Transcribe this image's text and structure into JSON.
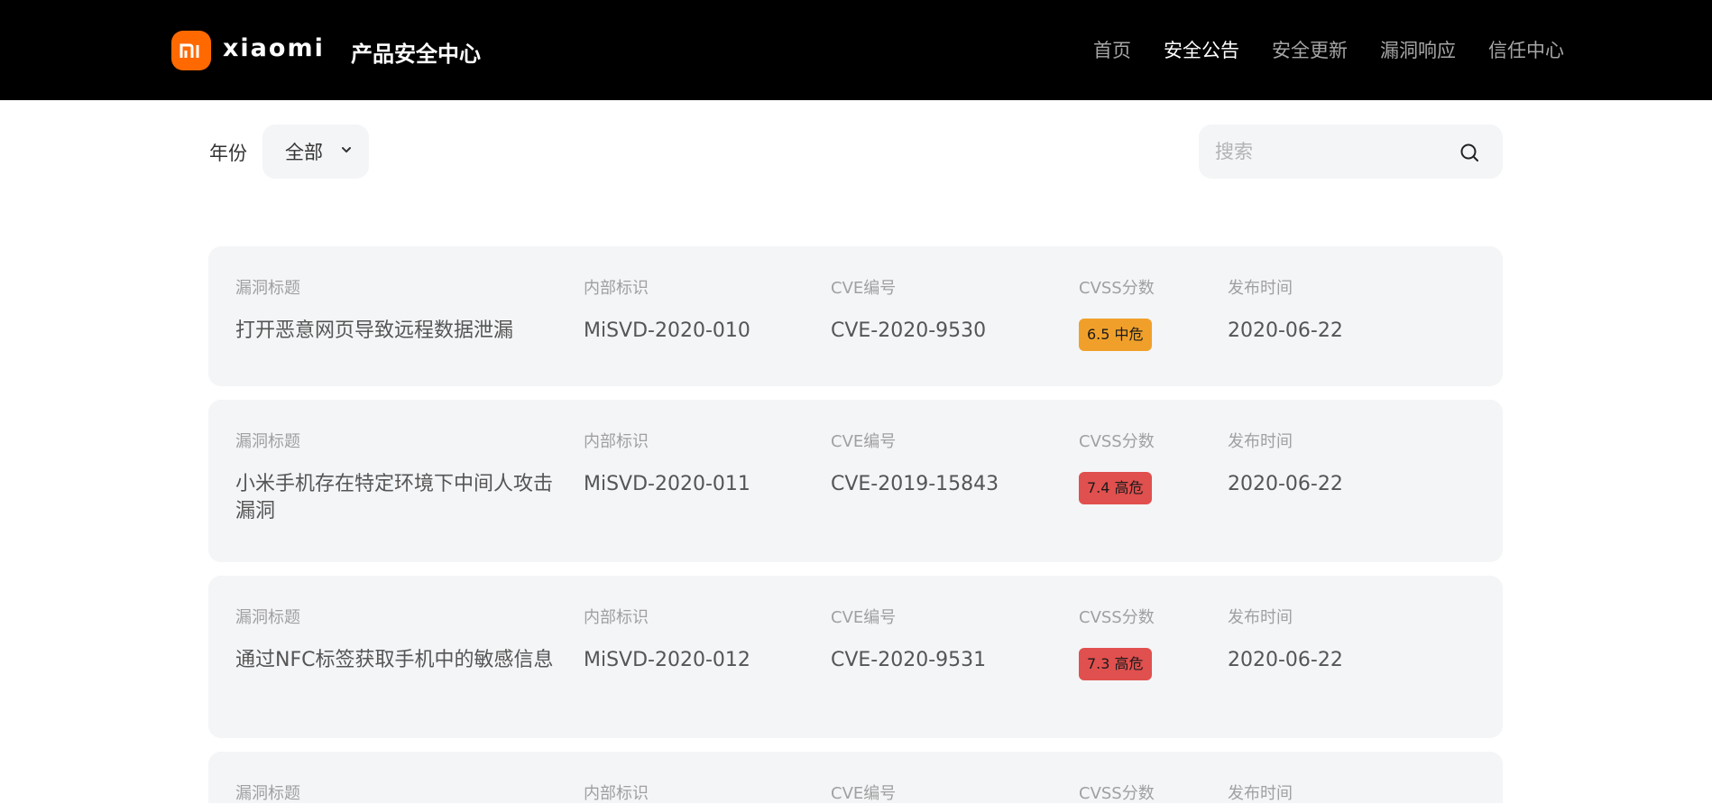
{
  "header": {
    "logo_mark": "mi",
    "logo_word": "xiaomi",
    "site_title": "产品安全中心",
    "nav": [
      {
        "label": "首页",
        "active": false
      },
      {
        "label": "安全公告",
        "active": true
      },
      {
        "label": "安全更新",
        "active": false
      },
      {
        "label": "漏洞响应",
        "active": false
      },
      {
        "label": "信任中心",
        "active": false
      }
    ],
    "brand_color": "#ff6900"
  },
  "filters": {
    "year_label": "年份",
    "year_value": "全部",
    "search_placeholder": "搜索"
  },
  "column_labels": {
    "title": "漏洞标题",
    "internal_id": "内部标识",
    "cve": "CVE编号",
    "cvss": "CVSS分数",
    "date": "发布时间"
  },
  "advisories": [
    {
      "title": "打开恶意网页导致远程数据泄漏",
      "internal_id": "MiSVD-2020-010",
      "cve": "CVE-2020-9530",
      "cvss": "6.5 中危",
      "severity": "medium",
      "date": "2020-06-22"
    },
    {
      "title": "小米手机存在特定环境下中间人攻击漏洞",
      "internal_id": "MiSVD-2020-011",
      "cve": "CVE-2019-15843",
      "cvss": "7.4 高危",
      "severity": "high",
      "date": "2020-06-22"
    },
    {
      "title": "通过NFC标签获取手机中的敏感信息",
      "internal_id": "MiSVD-2020-012",
      "cve": "CVE-2020-9531",
      "cvss": "7.3 高危",
      "severity": "high",
      "date": "2020-06-22"
    },
    {
      "title": "",
      "internal_id": "",
      "cve": "",
      "cvss": "",
      "severity": "",
      "date": ""
    }
  ],
  "severity_colors": {
    "medium": "#f0a02a",
    "high": "#e0504e"
  }
}
